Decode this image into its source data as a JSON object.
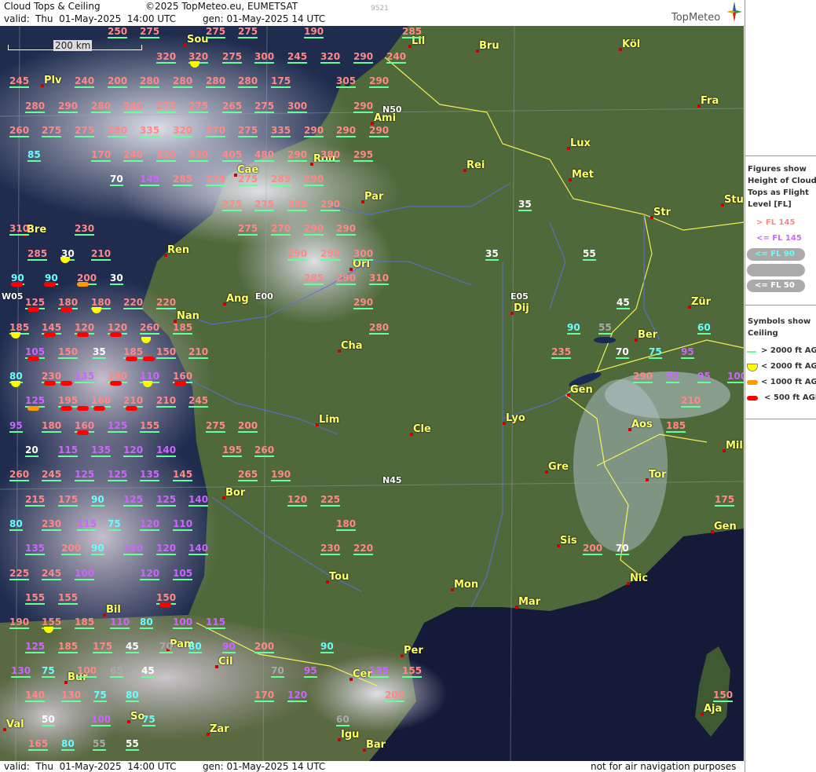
{
  "header": {
    "title": "Cloud Tops & Ceiling",
    "copyright": "©2025 TopMeteo.eu, EUMETSAT",
    "valid_label": "valid:",
    "valid_value": "Thu  01-May-2025  14:00 UTC",
    "gen": "gen: 01-May-2025 14 UTC",
    "code": "9521",
    "brand": "TopMeteo"
  },
  "footer": {
    "valid": "valid:  Thu  01-May-2025  14:00 UTC",
    "gen": "gen: 01-May-2025 14 UTC",
    "disclaimer": "not for air navigation purposes"
  },
  "scale": {
    "label": "200 km"
  },
  "grid_labels": [
    "N50",
    "N45",
    "W05",
    "E00",
    "E05"
  ],
  "legend": {
    "figures_title": "Figures show Height of Cloud Tops as Flight Level  [FL]",
    "figures": [
      {
        "label": "> FL 145",
        "color": "#ff8888"
      },
      {
        "label": "<= FL 145",
        "color": "#cc66ff"
      },
      {
        "label": "<= FL 90",
        "color": "#66ffff"
      },
      {
        "label": "<= FL 70",
        "color": "#aaaaaa"
      },
      {
        "label": "<= FL 50",
        "color": "#ffffff"
      }
    ],
    "symbols_title": "Symbols show Ceiling",
    "symbols": [
      {
        "label": "> 2000 ft AGL",
        "color": "#66ff99"
      },
      {
        "label": "< 2000 ft AGL",
        "color": "#ffff00"
      },
      {
        "label": "< 1000 ft AGL",
        "color": "#ff9900"
      },
      {
        "label": "< 500 ft AGL",
        "color": "#ff0000"
      }
    ]
  },
  "cities": [
    "Sou",
    "Lil",
    "Bru",
    "Köl",
    "Fra",
    "Plv",
    "Ami",
    "Lux",
    "Rou",
    "Rei",
    "Met",
    "Cae",
    "Par",
    "Stu",
    "Str",
    "Bre",
    "Ren",
    "Orl",
    "Ang",
    "Dij",
    "Zür",
    "Nan",
    "Ber",
    "Cha",
    "Gen",
    "Lim",
    "Cle",
    "Lyo",
    "Aos",
    "Mil",
    "Gre",
    "Tor",
    "Bor",
    "Sis",
    "Gen",
    "Nic",
    "Tou",
    "Mon",
    "Mar",
    "Bil",
    "Pam",
    "Per",
    "Cil",
    "Bur",
    "Cer",
    "Aja",
    "So",
    "Val",
    "Zar",
    "Igu",
    "Bar"
  ],
  "flight_levels": [
    {
      "v": "250",
      "c": "r"
    },
    {
      "v": "275",
      "c": "r"
    },
    {
      "v": "275",
      "c": "r"
    },
    {
      "v": "275",
      "c": "r"
    },
    {
      "v": "190",
      "c": "r"
    },
    {
      "v": "285",
      "c": "r"
    },
    {
      "v": "320",
      "c": "r"
    },
    {
      "v": "320",
      "c": "r"
    },
    {
      "v": "275",
      "c": "r"
    },
    {
      "v": "300",
      "c": "r"
    },
    {
      "v": "245",
      "c": "r"
    },
    {
      "v": "320",
      "c": "r"
    },
    {
      "v": "290",
      "c": "r"
    },
    {
      "v": "240",
      "c": "r"
    },
    {
      "v": "245",
      "c": "r"
    },
    {
      "v": "240",
      "c": "r"
    },
    {
      "v": "200",
      "c": "r"
    },
    {
      "v": "280",
      "c": "r"
    },
    {
      "v": "280",
      "c": "r"
    },
    {
      "v": "280",
      "c": "r"
    },
    {
      "v": "280",
      "c": "r"
    },
    {
      "v": "175",
      "c": "r"
    },
    {
      "v": "305",
      "c": "r"
    },
    {
      "v": "290",
      "c": "r"
    },
    {
      "v": "280",
      "c": "r"
    },
    {
      "v": "290",
      "c": "r"
    },
    {
      "v": "280",
      "c": "r"
    },
    {
      "v": "240",
      "c": "r"
    },
    {
      "v": "275",
      "c": "r"
    },
    {
      "v": "275",
      "c": "r"
    },
    {
      "v": "265",
      "c": "r"
    },
    {
      "v": "275",
      "c": "r"
    },
    {
      "v": "300",
      "c": "r"
    },
    {
      "v": "290",
      "c": "r"
    },
    {
      "v": "260",
      "c": "r"
    },
    {
      "v": "275",
      "c": "r"
    },
    {
      "v": "275",
      "c": "r"
    },
    {
      "v": "280",
      "c": "r"
    },
    {
      "v": "335",
      "c": "r"
    },
    {
      "v": "320",
      "c": "r"
    },
    {
      "v": "270",
      "c": "r"
    },
    {
      "v": "275",
      "c": "r"
    },
    {
      "v": "335",
      "c": "r"
    },
    {
      "v": "290",
      "c": "r"
    },
    {
      "v": "290",
      "c": "r"
    },
    {
      "v": "290",
      "c": "r"
    },
    {
      "v": "85",
      "c": "cy"
    },
    {
      "v": "170",
      "c": "r"
    },
    {
      "v": "240",
      "c": "r"
    },
    {
      "v": "320",
      "c": "r"
    },
    {
      "v": "330",
      "c": "r"
    },
    {
      "v": "405",
      "c": "r"
    },
    {
      "v": "480",
      "c": "r"
    },
    {
      "v": "290",
      "c": "r"
    },
    {
      "v": "380",
      "c": "r"
    },
    {
      "v": "295",
      "c": "r"
    },
    {
      "v": "70",
      "c": "w"
    },
    {
      "v": "145",
      "c": "p"
    },
    {
      "v": "285",
      "c": "r"
    },
    {
      "v": "275",
      "c": "r"
    },
    {
      "v": "275",
      "c": "r"
    },
    {
      "v": "285",
      "c": "r"
    },
    {
      "v": "290",
      "c": "r"
    },
    {
      "v": "275",
      "c": "r"
    },
    {
      "v": "275",
      "c": "r"
    },
    {
      "v": "295",
      "c": "r"
    },
    {
      "v": "290",
      "c": "r"
    },
    {
      "v": "35",
      "c": "w"
    },
    {
      "v": "310",
      "c": "r"
    },
    {
      "v": "230",
      "c": "r"
    },
    {
      "v": "275",
      "c": "r"
    },
    {
      "v": "270",
      "c": "r"
    },
    {
      "v": "290",
      "c": "r"
    },
    {
      "v": "290",
      "c": "r"
    },
    {
      "v": "285",
      "c": "r"
    },
    {
      "v": "30",
      "c": "w"
    },
    {
      "v": "210",
      "c": "r"
    },
    {
      "v": "290",
      "c": "r"
    },
    {
      "v": "290",
      "c": "r"
    },
    {
      "v": "300",
      "c": "r"
    },
    {
      "v": "35",
      "c": "w"
    },
    {
      "v": "55",
      "c": "w"
    },
    {
      "v": "90",
      "c": "cy"
    },
    {
      "v": "90",
      "c": "cy"
    },
    {
      "v": "200",
      "c": "r"
    },
    {
      "v": "30",
      "c": "w"
    },
    {
      "v": "285",
      "c": "r"
    },
    {
      "v": "290",
      "c": "r"
    },
    {
      "v": "310",
      "c": "r"
    },
    {
      "v": "125",
      "c": "r"
    },
    {
      "v": "180",
      "c": "r"
    },
    {
      "v": "180",
      "c": "r"
    },
    {
      "v": "220",
      "c": "r"
    },
    {
      "v": "220",
      "c": "r"
    },
    {
      "v": "290",
      "c": "r"
    },
    {
      "v": "45",
      "c": "w"
    },
    {
      "v": "185",
      "c": "r"
    },
    {
      "v": "145",
      "c": "r"
    },
    {
      "v": "120",
      "c": "r"
    },
    {
      "v": "120",
      "c": "r"
    },
    {
      "v": "260",
      "c": "r"
    },
    {
      "v": "185",
      "c": "r"
    },
    {
      "v": "280",
      "c": "r"
    },
    {
      "v": "90",
      "c": "cy"
    },
    {
      "v": "55",
      "c": "g"
    },
    {
      "v": "60",
      "c": "cy"
    },
    {
      "v": "105",
      "c": "p"
    },
    {
      "v": "150",
      "c": "r"
    },
    {
      "v": "35",
      "c": "w"
    },
    {
      "v": "185",
      "c": "r"
    },
    {
      "v": "150",
      "c": "r"
    },
    {
      "v": "210",
      "c": "r"
    },
    {
      "v": "235",
      "c": "r"
    },
    {
      "v": "70",
      "c": "w"
    },
    {
      "v": "75",
      "c": "cy"
    },
    {
      "v": "95",
      "c": "p"
    },
    {
      "v": "80",
      "c": "cy"
    },
    {
      "v": "230",
      "c": "r"
    },
    {
      "v": "135",
      "c": "p"
    },
    {
      "v": "190",
      "c": "r"
    },
    {
      "v": "110",
      "c": "p"
    },
    {
      "v": "160",
      "c": "r"
    },
    {
      "v": "290",
      "c": "r"
    },
    {
      "v": "95",
      "c": "p"
    },
    {
      "v": "95",
      "c": "p"
    },
    {
      "v": "100",
      "c": "p"
    },
    {
      "v": "125",
      "c": "p"
    },
    {
      "v": "195",
      "c": "r"
    },
    {
      "v": "160",
      "c": "r"
    },
    {
      "v": "210",
      "c": "r"
    },
    {
      "v": "210",
      "c": "r"
    },
    {
      "v": "245",
      "c": "r"
    },
    {
      "v": "210",
      "c": "r"
    },
    {
      "v": "95",
      "c": "p"
    },
    {
      "v": "180",
      "c": "r"
    },
    {
      "v": "160",
      "c": "r"
    },
    {
      "v": "125",
      "c": "p"
    },
    {
      "v": "155",
      "c": "r"
    },
    {
      "v": "275",
      "c": "r"
    },
    {
      "v": "200",
      "c": "r"
    },
    {
      "v": "185",
      "c": "r"
    },
    {
      "v": "20",
      "c": "w"
    },
    {
      "v": "115",
      "c": "p"
    },
    {
      "v": "135",
      "c": "p"
    },
    {
      "v": "120",
      "c": "p"
    },
    {
      "v": "140",
      "c": "p"
    },
    {
      "v": "195",
      "c": "r"
    },
    {
      "v": "260",
      "c": "r"
    },
    {
      "v": "260",
      "c": "r"
    },
    {
      "v": "245",
      "c": "r"
    },
    {
      "v": "125",
      "c": "p"
    },
    {
      "v": "125",
      "c": "p"
    },
    {
      "v": "135",
      "c": "p"
    },
    {
      "v": "145",
      "c": "r"
    },
    {
      "v": "265",
      "c": "r"
    },
    {
      "v": "190",
      "c": "r"
    },
    {
      "v": "215",
      "c": "r"
    },
    {
      "v": "175",
      "c": "r"
    },
    {
      "v": "90",
      "c": "cy"
    },
    {
      "v": "125",
      "c": "p"
    },
    {
      "v": "125",
      "c": "p"
    },
    {
      "v": "140",
      "c": "p"
    },
    {
      "v": "120",
      "c": "r"
    },
    {
      "v": "225",
      "c": "r"
    },
    {
      "v": "175",
      "c": "r"
    },
    {
      "v": "80",
      "c": "cy"
    },
    {
      "v": "230",
      "c": "r"
    },
    {
      "v": "115",
      "c": "p"
    },
    {
      "v": "75",
      "c": "cy"
    },
    {
      "v": "120",
      "c": "p"
    },
    {
      "v": "110",
      "c": "p"
    },
    {
      "v": "180",
      "c": "r"
    },
    {
      "v": "135",
      "c": "p"
    },
    {
      "v": "200",
      "c": "r"
    },
    {
      "v": "90",
      "c": "cy"
    },
    {
      "v": "120",
      "c": "p"
    },
    {
      "v": "120",
      "c": "p"
    },
    {
      "v": "140",
      "c": "p"
    },
    {
      "v": "230",
      "c": "r"
    },
    {
      "v": "220",
      "c": "r"
    },
    {
      "v": "200",
      "c": "r"
    },
    {
      "v": "70",
      "c": "w"
    },
    {
      "v": "225",
      "c": "r"
    },
    {
      "v": "245",
      "c": "r"
    },
    {
      "v": "100",
      "c": "p"
    },
    {
      "v": "120",
      "c": "p"
    },
    {
      "v": "105",
      "c": "p"
    },
    {
      "v": "155",
      "c": "r"
    },
    {
      "v": "155",
      "c": "r"
    },
    {
      "v": "150",
      "c": "r"
    },
    {
      "v": "190",
      "c": "r"
    },
    {
      "v": "155",
      "c": "r"
    },
    {
      "v": "185",
      "c": "r"
    },
    {
      "v": "110",
      "c": "p"
    },
    {
      "v": "80",
      "c": "cy"
    },
    {
      "v": "100",
      "c": "p"
    },
    {
      "v": "115",
      "c": "p"
    },
    {
      "v": "125",
      "c": "p"
    },
    {
      "v": "185",
      "c": "r"
    },
    {
      "v": "175",
      "c": "r"
    },
    {
      "v": "45",
      "c": "w"
    },
    {
      "v": "70",
      "c": "g"
    },
    {
      "v": "80",
      "c": "cy"
    },
    {
      "v": "90",
      "c": "p"
    },
    {
      "v": "200",
      "c": "r"
    },
    {
      "v": "90",
      "c": "cy"
    },
    {
      "v": "130",
      "c": "p"
    },
    {
      "v": "75",
      "c": "cy"
    },
    {
      "v": "100",
      "c": "r"
    },
    {
      "v": "65",
      "c": "g"
    },
    {
      "v": "45",
      "c": "w"
    },
    {
      "v": "70",
      "c": "g"
    },
    {
      "v": "95",
      "c": "p"
    },
    {
      "v": "135",
      "c": "p"
    },
    {
      "v": "155",
      "c": "r"
    },
    {
      "v": "140",
      "c": "r"
    },
    {
      "v": "130",
      "c": "r"
    },
    {
      "v": "75",
      "c": "cy"
    },
    {
      "v": "80",
      "c": "cy"
    },
    {
      "v": "170",
      "c": "r"
    },
    {
      "v": "120",
      "c": "p"
    },
    {
      "v": "200",
      "c": "r"
    },
    {
      "v": "150",
      "c": "r"
    },
    {
      "v": "50",
      "c": "w"
    },
    {
      "v": "100",
      "c": "p"
    },
    {
      "v": "75",
      "c": "cy"
    },
    {
      "v": "60",
      "c": "g"
    },
    {
      "v": "165",
      "c": "r"
    },
    {
      "v": "80",
      "c": "cy"
    },
    {
      "v": "55",
      "c": "g"
    },
    {
      "v": "55",
      "c": "w"
    },
    {
      "v": "90",
      "c": "cy"
    }
  ],
  "ceiling_symbols": [
    "y",
    "y",
    "y",
    "o",
    "r",
    "r",
    "r",
    "r",
    "y",
    "y",
    "r",
    "r",
    "r",
    "r",
    "r",
    "r",
    "y",
    "o",
    "r",
    "r",
    "r",
    "y",
    "r",
    "r",
    "r",
    "r",
    "r",
    "r",
    "y",
    "r"
  ]
}
